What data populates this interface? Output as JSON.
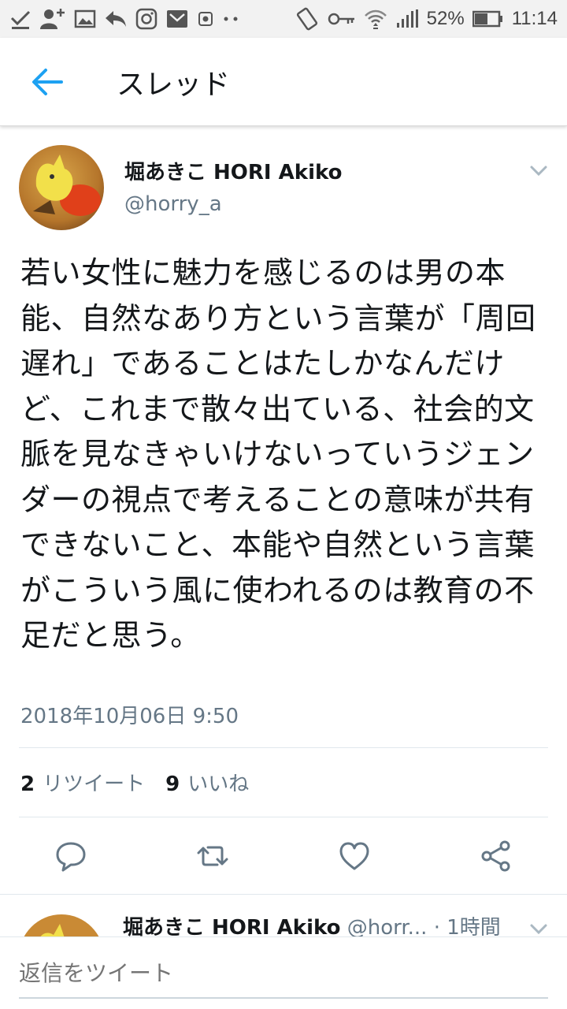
{
  "status_bar": {
    "battery": "52%",
    "time": "11:14",
    "icons_left": [
      "check-icon",
      "add-user-icon",
      "image-icon",
      "reply-icon",
      "instagram-icon",
      "mail-icon",
      "record-icon",
      "dots-icon"
    ],
    "icons_right": [
      "rotate-icon",
      "key-icon",
      "wifi-icon",
      "signal-icon",
      "battery-icon"
    ]
  },
  "header": {
    "title": "スレッド",
    "back_icon": "back-arrow-icon",
    "accent": "#1da1f2"
  },
  "tweet": {
    "author_name": "堀あきこ HORI Akiko",
    "author_handle": "@horry_a",
    "text": "若い女性に魅力を感じるのは男の本能、自然なあり方という言葉が「周回遅れ」であることはたしかなんだけど、これまで散々出ている、社会的文脈を見なきゃいけないっていうジェンダーの視点で考えることの意味が共有できないこと、本能や自然という言葉がこういう風に使われるのは教育の不足だと思う。",
    "timestamp": "2018年10月06日 9:50",
    "retweet_count": "2",
    "retweet_label": "リツイート",
    "like_count": "9",
    "like_label": "いいね",
    "actions": [
      "reply-icon",
      "retweet-icon",
      "like-icon",
      "share-icon"
    ]
  },
  "next_tweet": {
    "author_name": "堀あきこ HORI Akiko",
    "author_handle": "@horr...",
    "time": "· 1時間"
  },
  "reply": {
    "placeholder": "返信をツイート"
  },
  "colors": {
    "text": "#14171a",
    "secondary": "#657786",
    "divider": "#e1e8ed",
    "accent": "#1da1f2"
  }
}
